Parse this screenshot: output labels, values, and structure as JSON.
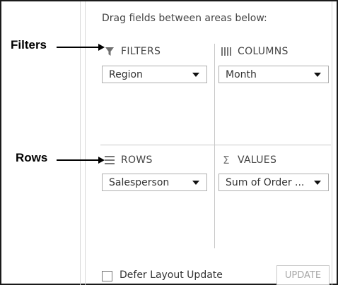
{
  "annotations": {
    "filters_label": "Filters",
    "rows_label": "Rows"
  },
  "header": {
    "instruction": "Drag fields between areas below:"
  },
  "areas": {
    "filters": {
      "title": "FILTERS",
      "icon": "filter-icon",
      "field": "Region"
    },
    "columns": {
      "title": "COLUMNS",
      "icon": "columns-icon",
      "field": "Month"
    },
    "rows": {
      "title": "ROWS",
      "icon": "rows-icon",
      "field": "Salesperson"
    },
    "values": {
      "title": "VALUES",
      "icon": "sigma-icon",
      "field": "Sum of Order ..."
    }
  },
  "footer": {
    "defer_label": "Defer Layout Update",
    "defer_checked": false,
    "update_label": "UPDATE"
  }
}
